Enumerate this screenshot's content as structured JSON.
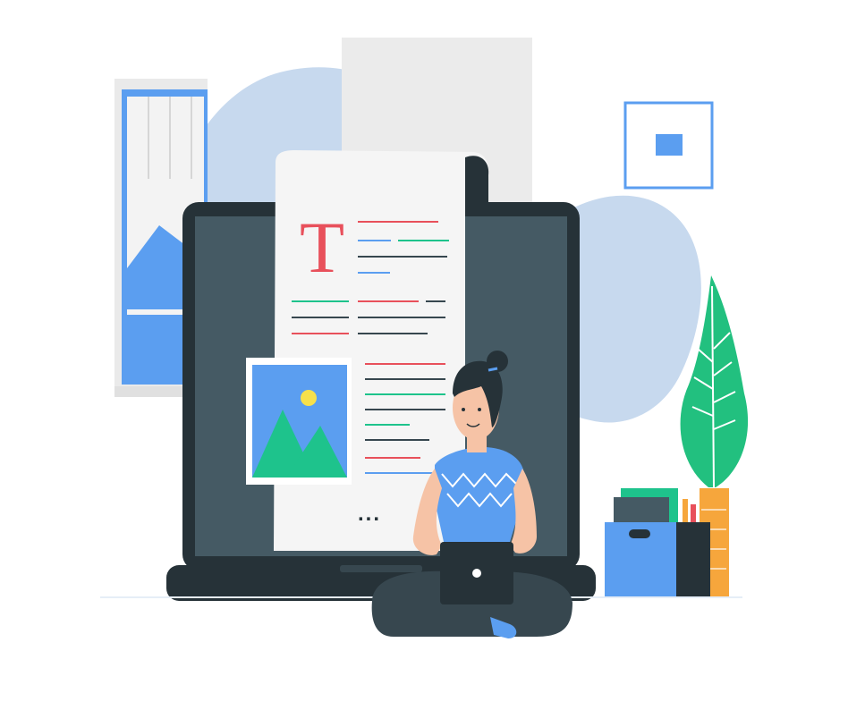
{
  "document": {
    "title_letter": "T",
    "ellipsis": "..."
  },
  "colors": {
    "blob": "#c7d9ee",
    "laptop_frame": "#263238",
    "laptop_screen": "#455a64",
    "paper": "#f5f5f5",
    "accent_red": "#e8505b",
    "accent_blue": "#5b9ef0",
    "accent_green": "#1ec38c",
    "text_dark": "#37474f",
    "person_skin": "#f6c3a6",
    "plant_green": "#22c07f",
    "pot_orange": "#f6a63c"
  },
  "icons": {
    "document_image": "picture-mountain-sun-icon",
    "wall_frame": "square-frame-icon",
    "laptop_logo": "laptop-logo-icon"
  }
}
